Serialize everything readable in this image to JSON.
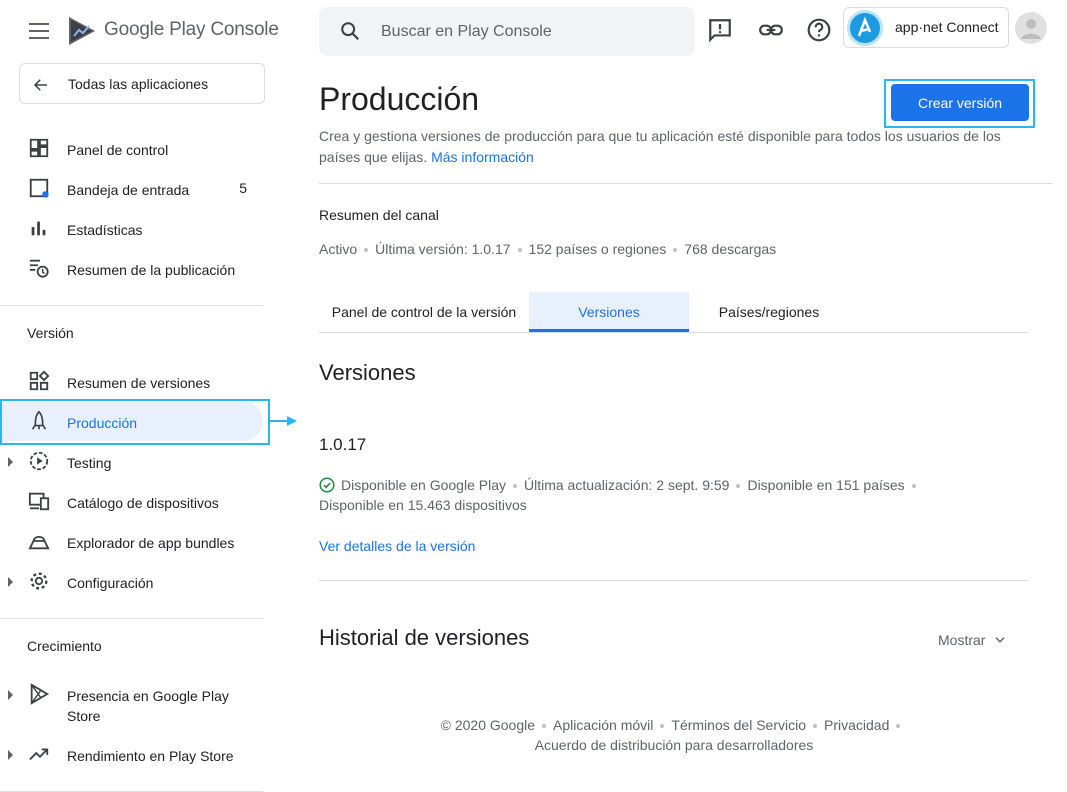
{
  "header": {
    "brand": "Google Play Console",
    "search_placeholder": "Buscar en Play Console",
    "account_name": "app·net Connect",
    "icons": [
      "menu-icon",
      "feedback-icon",
      "link-icon",
      "help-icon",
      "account-avatar"
    ]
  },
  "sidebar": {
    "back_label": "Todas las aplicaciones",
    "top_items": [
      {
        "label": "Panel de control",
        "icon": "dashboard-icon"
      },
      {
        "label": "Bandeja de entrada",
        "icon": "inbox-icon",
        "count": "5"
      },
      {
        "label": "Estadísticas",
        "icon": "stats-icon"
      },
      {
        "label": "Resumen de la publicación",
        "icon": "publishing-icon"
      }
    ],
    "release_section": "Versión",
    "release_items": [
      {
        "label": "Resumen de versiones",
        "icon": "releases-overview-icon"
      },
      {
        "label": "Producción",
        "icon": "production-icon",
        "active": true
      },
      {
        "label": "Testing",
        "icon": "testing-icon",
        "expandable": true
      },
      {
        "label": "Catálogo de dispositivos",
        "icon": "device-catalog-icon"
      },
      {
        "label": "Explorador de app bundles",
        "icon": "app-bundle-icon"
      },
      {
        "label": "Configuración",
        "icon": "settings-icon",
        "expandable": true
      }
    ],
    "growth_section": "Crecimiento",
    "growth_items": [
      {
        "label_line1": "Presencia en Google Play",
        "label_line2": "Store",
        "icon": "play-store-icon",
        "expandable": true
      },
      {
        "label": "Rendimiento en Play Store",
        "icon": "trending-icon",
        "expandable": true
      }
    ]
  },
  "main": {
    "title": "Producción",
    "create_button": "Crear versión",
    "description": "Crea y gestiona versiones de producción para que tu aplicación esté disponible para todos los usuarios de los países que elijas.",
    "more_info": "Más información",
    "summary_title": "Resumen del canal",
    "summary": [
      "Activo",
      "Última versión: 1.0.17",
      "152 países o regiones",
      "768 descargas"
    ],
    "tabs": [
      "Panel de control de la versión",
      "Versiones",
      "Países/regiones"
    ],
    "active_tab": "Versiones",
    "versions_title": "Versiones",
    "version": {
      "number": "1.0.17",
      "status": "Disponible en Google Play",
      "updated": "Última actualización: 2 sept. 9:59",
      "countries": "Disponible en 151 países",
      "devices": "Disponible en 15.463 dispositivos",
      "details_link": "Ver detalles de la versión"
    },
    "history_title": "Historial de versiones",
    "show_label": "Mostrar"
  },
  "footer": {
    "items": [
      "© 2020 Google",
      "Aplicación móvil",
      "Términos del Servicio",
      "Privacidad"
    ],
    "line2": "Acuerdo de distribución para desarrolladores"
  },
  "colors": {
    "accent": "#1a73e8",
    "highlight_frame": "#29b6f6",
    "active_bg": "#e8f0fe",
    "success": "#1e8e3e"
  }
}
